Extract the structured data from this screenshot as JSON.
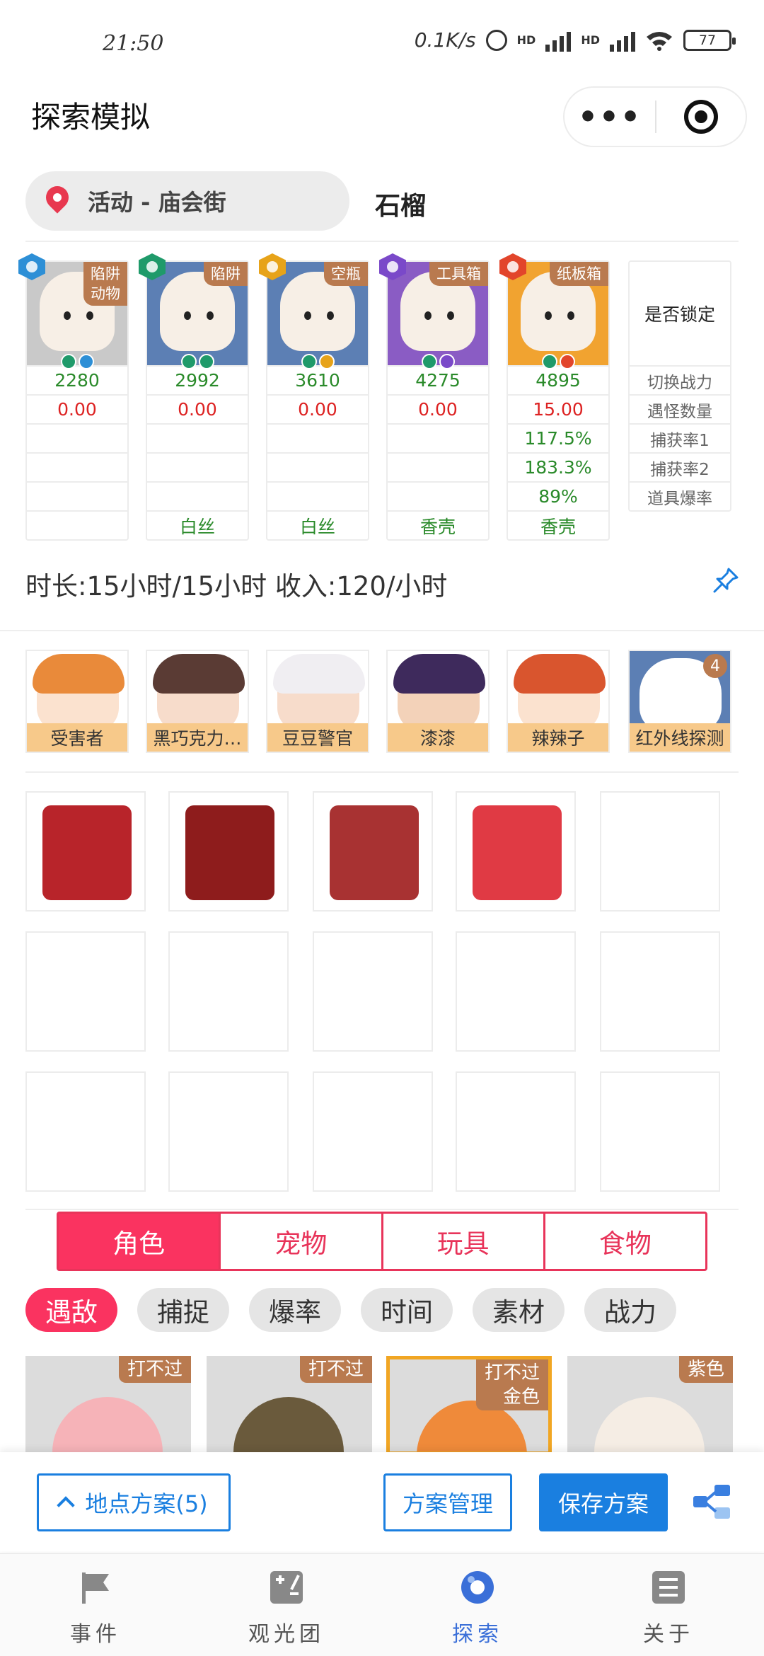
{
  "status": {
    "time": "21:50",
    "net_speed": "0.1K/s",
    "hd1": "HD",
    "hd2": "HD",
    "battery": "77"
  },
  "header": {
    "title": "探索模拟",
    "more_icon": "more-dots-icon",
    "close_icon": "target-icon"
  },
  "location": {
    "label": "活动 - 庙会街",
    "name": "石榴"
  },
  "team": [
    {
      "trait": "陷阱\n动物",
      "power": "2280",
      "monsters": "0.00",
      "rate1": "",
      "rate2": "",
      "drop": "",
      "material": "",
      "bg": "#c9c9c9",
      "elem": "#2d8fd6"
    },
    {
      "trait": "陷阱",
      "power": "2992",
      "monsters": "0.00",
      "rate1": "",
      "rate2": "",
      "drop": "",
      "material": "白丝",
      "bg": "#5c7fb4",
      "elem": "#1f9a6a"
    },
    {
      "trait": "空瓶",
      "power": "3610",
      "monsters": "0.00",
      "rate1": "",
      "rate2": "",
      "drop": "",
      "material": "白丝",
      "bg": "#5c7fb4",
      "elem": "#e7a319"
    },
    {
      "trait": "工具箱",
      "power": "4275",
      "monsters": "0.00",
      "rate1": "",
      "rate2": "",
      "drop": "",
      "material": "香壳",
      "bg": "#8a5cc4",
      "elem": "#7a49c9"
    },
    {
      "trait": "纸板箱",
      "power": "4895",
      "monsters": "15.00",
      "rate1": "117.5%",
      "rate2": "183.3%",
      "drop": "89%",
      "material": "香壳",
      "bg": "#f1a330",
      "elem": "#e2452b"
    }
  ],
  "lock_column": {
    "header": "是否锁定",
    "rows": [
      "切换战力",
      "遇怪数量",
      "捕获率1",
      "捕获率2",
      "道具爆率"
    ]
  },
  "summary": {
    "text": "时长:15小时/15小时 收入:120/小时"
  },
  "heroes": [
    {
      "name": "受害者",
      "hair": "#e98a3a",
      "skin": "#fbe2cf"
    },
    {
      "name": "黑巧克力…",
      "hair": "#5a3b34",
      "skin": "#f7dccb"
    },
    {
      "name": "豆豆警官",
      "hair": "#f0eef2",
      "skin": "#f7dccb"
    },
    {
      "name": "漆漆",
      "hair": "#3e2a5c",
      "skin": "#f3d2b9"
    },
    {
      "name": "辣辣子",
      "hair": "#d9552e",
      "skin": "#fbe2cf"
    },
    {
      "name": "红外线探测",
      "hair": "#5c7fb4",
      "skin": "#ffffff",
      "count": "4"
    }
  ],
  "items": [
    {
      "color": "#b8242a"
    },
    {
      "color": "#8e1c1c"
    },
    {
      "color": "#a83232"
    },
    {
      "color": "#e03a44"
    },
    {
      "color": ""
    },
    {
      "color": ""
    },
    {
      "color": ""
    },
    {
      "color": ""
    },
    {
      "color": ""
    },
    {
      "color": ""
    },
    {
      "color": ""
    },
    {
      "color": ""
    },
    {
      "color": ""
    },
    {
      "color": ""
    },
    {
      "color": ""
    }
  ],
  "tabs": [
    "角色",
    "宠物",
    "玩具",
    "食物"
  ],
  "filters": [
    "遇敌",
    "捕捉",
    "爆率",
    "时间",
    "素材",
    "战力"
  ],
  "cards": [
    {
      "tag": "打不过",
      "color": "#f6b3b8"
    },
    {
      "tag": "打不过",
      "color": "#6a5a3c"
    },
    {
      "tag": "打不过\n金色",
      "color": "#ef8a3a"
    },
    {
      "tag": "紫色",
      "color": "#f5ede4"
    }
  ],
  "actions": {
    "plans": "地点方案(5)",
    "manage": "方案管理",
    "save": "保存方案"
  },
  "nav": [
    {
      "label": "事件",
      "icon": "flag-icon"
    },
    {
      "label": "观光团",
      "icon": "calculator-icon"
    },
    {
      "label": "探索",
      "icon": "explore-icon"
    },
    {
      "label": "关于",
      "icon": "list-icon"
    }
  ]
}
